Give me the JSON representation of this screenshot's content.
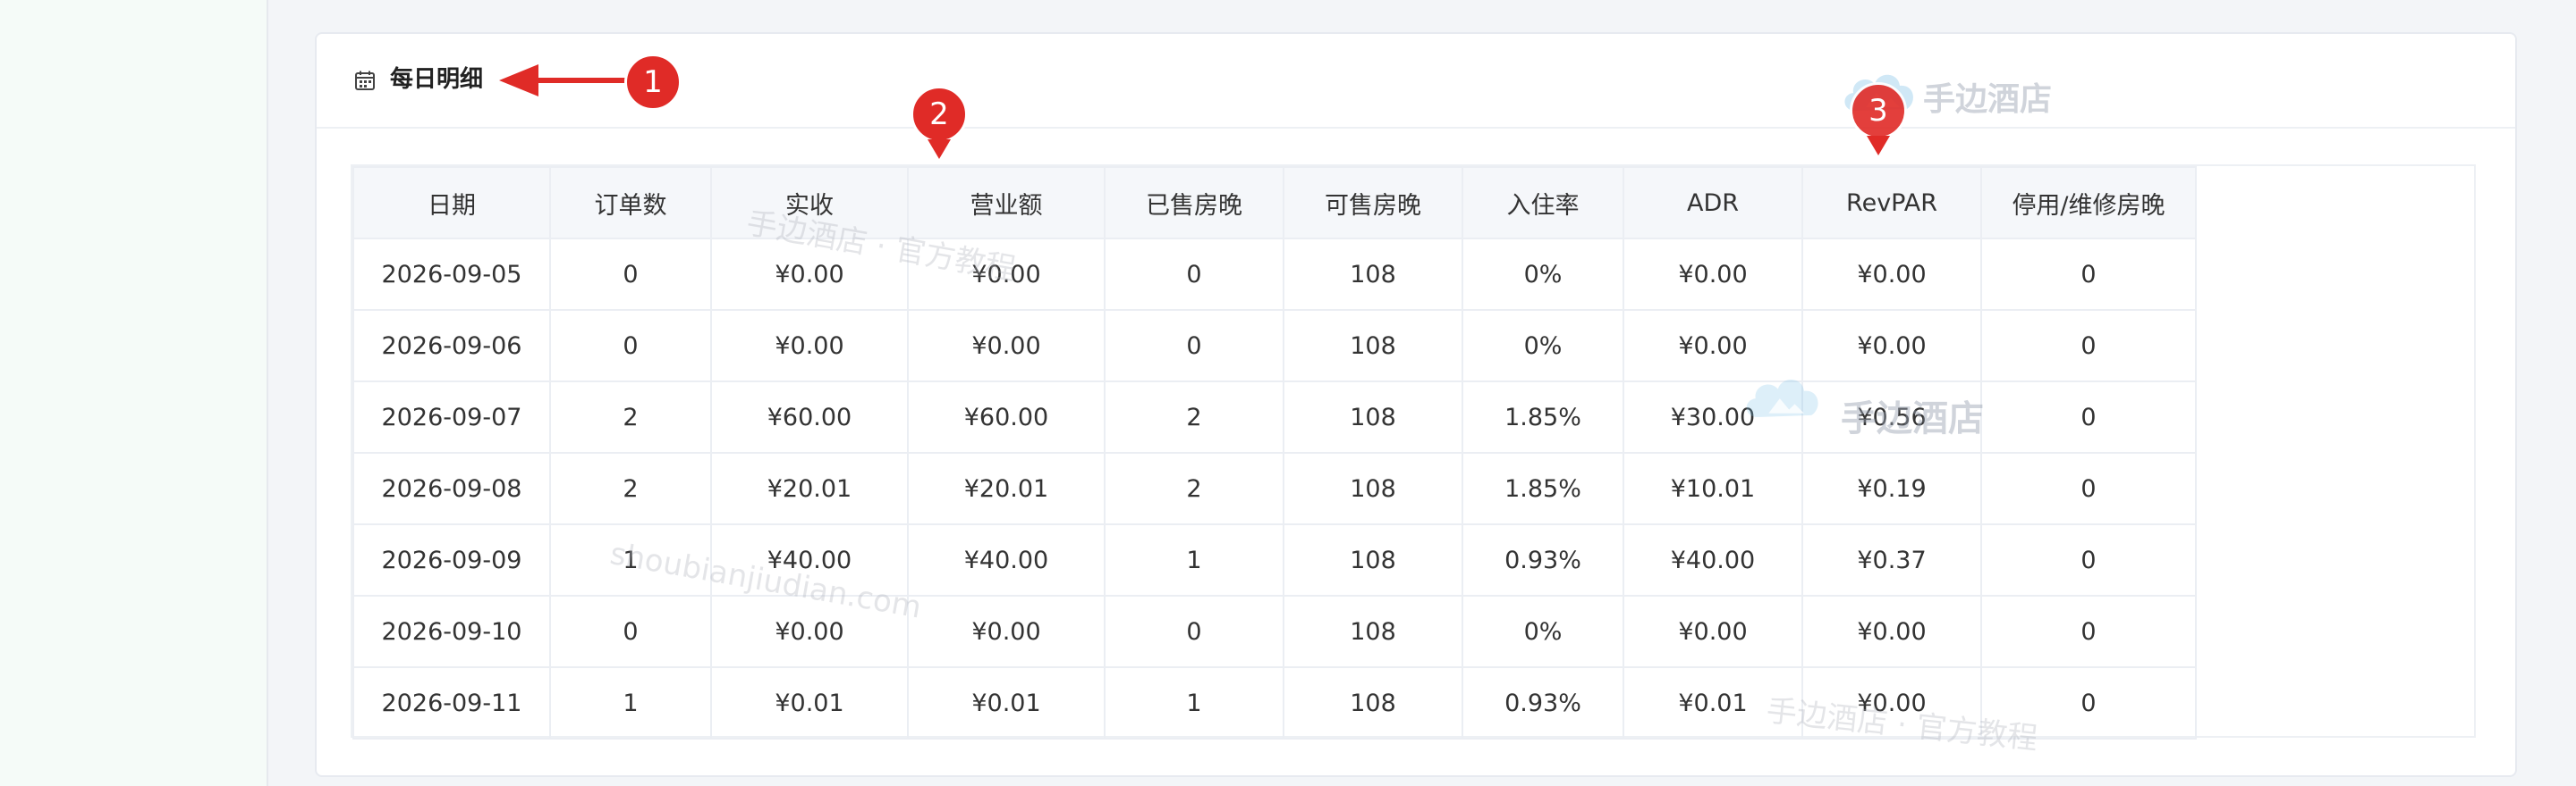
{
  "section": {
    "title": "每日明细"
  },
  "table": {
    "headers": [
      "日期",
      "订单数",
      "实收",
      "营业额",
      "已售房晚",
      "可售房晚",
      "入住率",
      "ADR",
      "RevPAR",
      "停用/维修房晚"
    ],
    "rows": [
      [
        "2026-09-05",
        "0",
        "¥0.00",
        "¥0.00",
        "0",
        "108",
        "0%",
        "¥0.00",
        "¥0.00",
        "0"
      ],
      [
        "2026-09-06",
        "0",
        "¥0.00",
        "¥0.00",
        "0",
        "108",
        "0%",
        "¥0.00",
        "¥0.00",
        "0"
      ],
      [
        "2026-09-07",
        "2",
        "¥60.00",
        "¥60.00",
        "2",
        "108",
        "1.85%",
        "¥30.00",
        "¥0.56",
        "0"
      ],
      [
        "2026-09-08",
        "2",
        "¥20.01",
        "¥20.01",
        "2",
        "108",
        "1.85%",
        "¥10.01",
        "¥0.19",
        "0"
      ],
      [
        "2026-09-09",
        "1",
        "¥40.00",
        "¥40.00",
        "1",
        "108",
        "0.93%",
        "¥40.00",
        "¥0.37",
        "0"
      ],
      [
        "2026-09-10",
        "0",
        "¥0.00",
        "¥0.00",
        "0",
        "108",
        "0%",
        "¥0.00",
        "¥0.00",
        "0"
      ],
      [
        "2026-09-11",
        "1",
        "¥0.01",
        "¥0.01",
        "1",
        "108",
        "0.93%",
        "¥0.01",
        "¥0.00",
        "0"
      ]
    ]
  },
  "markers": [
    "1",
    "2",
    "3"
  ],
  "watermarks": {
    "logo": "手边酒店",
    "tagline": "手边酒店 · 官方教程",
    "url": "shoubianjiudian.com"
  },
  "colors": {
    "marker": "#e02b27",
    "header_bg": "#f5f7fa",
    "border": "#ebeef3"
  }
}
